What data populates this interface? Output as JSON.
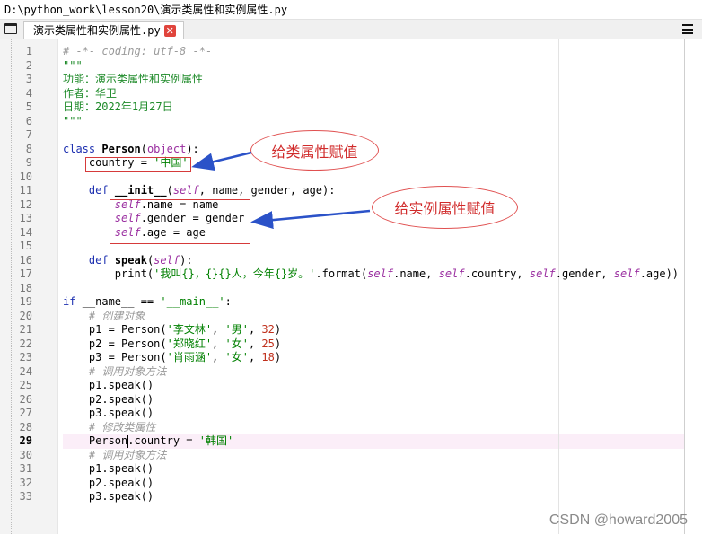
{
  "window": {
    "title": "D:\\python_work\\lesson20\\演示类属性和实例属性.py"
  },
  "tab": {
    "label": "演示类属性和实例属性.py",
    "close_label": "✕"
  },
  "editor": {
    "active_line": 29,
    "lines": [
      {
        "n": 1,
        "tokens": [
          {
            "t": "# -*- coding: utf-8 -*-",
            "c": "com"
          }
        ]
      },
      {
        "n": 2,
        "tokens": [
          {
            "t": "\"\"\"",
            "c": "doc"
          }
        ]
      },
      {
        "n": 3,
        "tokens": [
          {
            "t": "功能：演示类属性和实例属性",
            "c": "doc"
          }
        ]
      },
      {
        "n": 4,
        "tokens": [
          {
            "t": "作者：华卫",
            "c": "doc"
          }
        ]
      },
      {
        "n": 5,
        "tokens": [
          {
            "t": "日期：2022年1月27日",
            "c": "doc"
          }
        ]
      },
      {
        "n": 6,
        "tokens": [
          {
            "t": "\"\"\"",
            "c": "doc"
          }
        ]
      },
      {
        "n": 7,
        "tokens": []
      },
      {
        "n": 8,
        "tokens": [
          {
            "t": "class ",
            "c": "kw"
          },
          {
            "t": "Person",
            "c": "def"
          },
          {
            "t": "(",
            "c": ""
          },
          {
            "t": "object",
            "c": "sup"
          },
          {
            "t": "):",
            "c": ""
          }
        ]
      },
      {
        "n": 9,
        "tokens": [
          {
            "t": "    country = ",
            "c": ""
          },
          {
            "t": "'中国'",
            "c": "str"
          }
        ]
      },
      {
        "n": 10,
        "tokens": []
      },
      {
        "n": 11,
        "tokens": [
          {
            "t": "    ",
            "c": ""
          },
          {
            "t": "def ",
            "c": "kw"
          },
          {
            "t": "__init__",
            "c": "def"
          },
          {
            "t": "(",
            "c": ""
          },
          {
            "t": "self",
            "c": "self"
          },
          {
            "t": ", name, gender, age):",
            "c": ""
          }
        ]
      },
      {
        "n": 12,
        "tokens": [
          {
            "t": "        ",
            "c": ""
          },
          {
            "t": "self",
            "c": "self"
          },
          {
            "t": ".name = name",
            "c": ""
          }
        ]
      },
      {
        "n": 13,
        "tokens": [
          {
            "t": "        ",
            "c": ""
          },
          {
            "t": "self",
            "c": "self"
          },
          {
            "t": ".gender = gender",
            "c": ""
          }
        ]
      },
      {
        "n": 14,
        "tokens": [
          {
            "t": "        ",
            "c": ""
          },
          {
            "t": "self",
            "c": "self"
          },
          {
            "t": ".age = age",
            "c": ""
          }
        ]
      },
      {
        "n": 15,
        "tokens": []
      },
      {
        "n": 16,
        "tokens": [
          {
            "t": "    ",
            "c": ""
          },
          {
            "t": "def ",
            "c": "kw"
          },
          {
            "t": "speak",
            "c": "def"
          },
          {
            "t": "(",
            "c": ""
          },
          {
            "t": "self",
            "c": "self"
          },
          {
            "t": "):",
            "c": ""
          }
        ]
      },
      {
        "n": 17,
        "tokens": [
          {
            "t": "        print(",
            "c": ""
          },
          {
            "t": "'我叫{}，{}{}人，今年{}岁。'",
            "c": "str"
          },
          {
            "t": ".format(",
            "c": ""
          },
          {
            "t": "self",
            "c": "self"
          },
          {
            "t": ".name, ",
            "c": ""
          },
          {
            "t": "self",
            "c": "self"
          },
          {
            "t": ".country, ",
            "c": ""
          },
          {
            "t": "self",
            "c": "self"
          },
          {
            "t": ".gender, ",
            "c": ""
          },
          {
            "t": "self",
            "c": "self"
          },
          {
            "t": ".age))",
            "c": ""
          }
        ]
      },
      {
        "n": 18,
        "tokens": []
      },
      {
        "n": 19,
        "tokens": [
          {
            "t": "if ",
            "c": "kw"
          },
          {
            "t": "__name__ == ",
            "c": ""
          },
          {
            "t": "'__main__'",
            "c": "str"
          },
          {
            "t": ":",
            "c": ""
          }
        ]
      },
      {
        "n": 20,
        "tokens": [
          {
            "t": "    ",
            "c": ""
          },
          {
            "t": "# 创建对象",
            "c": "com"
          }
        ]
      },
      {
        "n": 21,
        "tokens": [
          {
            "t": "    p1 = Person(",
            "c": ""
          },
          {
            "t": "'李文林'",
            "c": "str"
          },
          {
            "t": ", ",
            "c": ""
          },
          {
            "t": "'男'",
            "c": "str"
          },
          {
            "t": ", ",
            "c": ""
          },
          {
            "t": "32",
            "c": "num"
          },
          {
            "t": ")",
            "c": ""
          }
        ]
      },
      {
        "n": 22,
        "tokens": [
          {
            "t": "    p2 = Person(",
            "c": ""
          },
          {
            "t": "'郑晓红'",
            "c": "str"
          },
          {
            "t": ", ",
            "c": ""
          },
          {
            "t": "'女'",
            "c": "str"
          },
          {
            "t": ", ",
            "c": ""
          },
          {
            "t": "25",
            "c": "num"
          },
          {
            "t": ")",
            "c": ""
          }
        ]
      },
      {
        "n": 23,
        "tokens": [
          {
            "t": "    p3 = Person(",
            "c": ""
          },
          {
            "t": "'肖雨涵'",
            "c": "str"
          },
          {
            "t": ", ",
            "c": ""
          },
          {
            "t": "'女'",
            "c": "str"
          },
          {
            "t": ", ",
            "c": ""
          },
          {
            "t": "18",
            "c": "num"
          },
          {
            "t": ")",
            "c": ""
          }
        ]
      },
      {
        "n": 24,
        "tokens": [
          {
            "t": "    ",
            "c": ""
          },
          {
            "t": "# 调用对象方法",
            "c": "com"
          }
        ]
      },
      {
        "n": 25,
        "tokens": [
          {
            "t": "    p1.speak()",
            "c": ""
          }
        ]
      },
      {
        "n": 26,
        "tokens": [
          {
            "t": "    p2.speak()",
            "c": ""
          }
        ]
      },
      {
        "n": 27,
        "tokens": [
          {
            "t": "    p3.speak()",
            "c": ""
          }
        ]
      },
      {
        "n": 28,
        "tokens": [
          {
            "t": "    ",
            "c": ""
          },
          {
            "t": "# 修改类属性",
            "c": "com"
          }
        ]
      },
      {
        "n": 29,
        "tokens": [
          {
            "t": "    Person.country = ",
            "c": ""
          },
          {
            "t": "'韩国'",
            "c": "str"
          }
        ]
      },
      {
        "n": 30,
        "tokens": [
          {
            "t": "    ",
            "c": ""
          },
          {
            "t": "# 调用对象方法",
            "c": "com"
          }
        ]
      },
      {
        "n": 31,
        "tokens": [
          {
            "t": "    p1.speak()",
            "c": ""
          }
        ]
      },
      {
        "n": 32,
        "tokens": [
          {
            "t": "    p2.speak()",
            "c": ""
          }
        ]
      },
      {
        "n": 33,
        "tokens": [
          {
            "t": "    p3.speak()",
            "c": ""
          }
        ]
      }
    ]
  },
  "annotations": {
    "class_attr_label": "给类属性赋值",
    "instance_attr_label": "给实例属性赋值",
    "highlight_color": "#d63a3a",
    "arrow_color": "#2b52c8"
  },
  "watermark": "CSDN @howard2005",
  "icons": {
    "window": "window-icon",
    "menu": "hamburger-menu-icon",
    "close": "close-icon"
  }
}
